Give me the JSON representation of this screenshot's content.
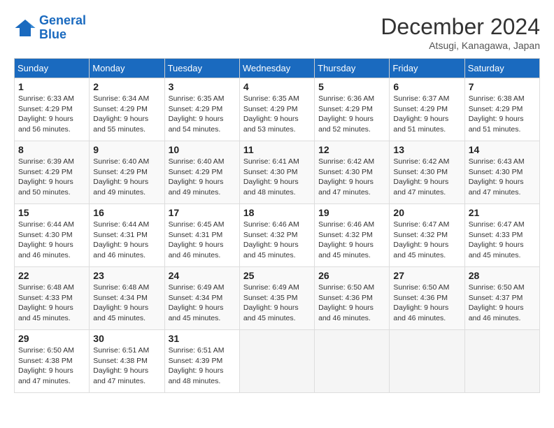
{
  "logo": {
    "line1": "General",
    "line2": "Blue"
  },
  "title": "December 2024",
  "location": "Atsugi, Kanagawa, Japan",
  "days_of_week": [
    "Sunday",
    "Monday",
    "Tuesday",
    "Wednesday",
    "Thursday",
    "Friday",
    "Saturday"
  ],
  "weeks": [
    [
      {
        "day": "1",
        "sunrise": "6:33 AM",
        "sunset": "4:29 PM",
        "daylight": "9 hours and 56 minutes."
      },
      {
        "day": "2",
        "sunrise": "6:34 AM",
        "sunset": "4:29 PM",
        "daylight": "9 hours and 55 minutes."
      },
      {
        "day": "3",
        "sunrise": "6:35 AM",
        "sunset": "4:29 PM",
        "daylight": "9 hours and 54 minutes."
      },
      {
        "day": "4",
        "sunrise": "6:35 AM",
        "sunset": "4:29 PM",
        "daylight": "9 hours and 53 minutes."
      },
      {
        "day": "5",
        "sunrise": "6:36 AM",
        "sunset": "4:29 PM",
        "daylight": "9 hours and 52 minutes."
      },
      {
        "day": "6",
        "sunrise": "6:37 AM",
        "sunset": "4:29 PM",
        "daylight": "9 hours and 51 minutes."
      },
      {
        "day": "7",
        "sunrise": "6:38 AM",
        "sunset": "4:29 PM",
        "daylight": "9 hours and 51 minutes."
      }
    ],
    [
      {
        "day": "8",
        "sunrise": "6:39 AM",
        "sunset": "4:29 PM",
        "daylight": "9 hours and 50 minutes."
      },
      {
        "day": "9",
        "sunrise": "6:40 AM",
        "sunset": "4:29 PM",
        "daylight": "9 hours and 49 minutes."
      },
      {
        "day": "10",
        "sunrise": "6:40 AM",
        "sunset": "4:29 PM",
        "daylight": "9 hours and 49 minutes."
      },
      {
        "day": "11",
        "sunrise": "6:41 AM",
        "sunset": "4:30 PM",
        "daylight": "9 hours and 48 minutes."
      },
      {
        "day": "12",
        "sunrise": "6:42 AM",
        "sunset": "4:30 PM",
        "daylight": "9 hours and 47 minutes."
      },
      {
        "day": "13",
        "sunrise": "6:42 AM",
        "sunset": "4:30 PM",
        "daylight": "9 hours and 47 minutes."
      },
      {
        "day": "14",
        "sunrise": "6:43 AM",
        "sunset": "4:30 PM",
        "daylight": "9 hours and 47 minutes."
      }
    ],
    [
      {
        "day": "15",
        "sunrise": "6:44 AM",
        "sunset": "4:30 PM",
        "daylight": "9 hours and 46 minutes."
      },
      {
        "day": "16",
        "sunrise": "6:44 AM",
        "sunset": "4:31 PM",
        "daylight": "9 hours and 46 minutes."
      },
      {
        "day": "17",
        "sunrise": "6:45 AM",
        "sunset": "4:31 PM",
        "daylight": "9 hours and 46 minutes."
      },
      {
        "day": "18",
        "sunrise": "6:46 AM",
        "sunset": "4:32 PM",
        "daylight": "9 hours and 45 minutes."
      },
      {
        "day": "19",
        "sunrise": "6:46 AM",
        "sunset": "4:32 PM",
        "daylight": "9 hours and 45 minutes."
      },
      {
        "day": "20",
        "sunrise": "6:47 AM",
        "sunset": "4:32 PM",
        "daylight": "9 hours and 45 minutes."
      },
      {
        "day": "21",
        "sunrise": "6:47 AM",
        "sunset": "4:33 PM",
        "daylight": "9 hours and 45 minutes."
      }
    ],
    [
      {
        "day": "22",
        "sunrise": "6:48 AM",
        "sunset": "4:33 PM",
        "daylight": "9 hours and 45 minutes."
      },
      {
        "day": "23",
        "sunrise": "6:48 AM",
        "sunset": "4:34 PM",
        "daylight": "9 hours and 45 minutes."
      },
      {
        "day": "24",
        "sunrise": "6:49 AM",
        "sunset": "4:34 PM",
        "daylight": "9 hours and 45 minutes."
      },
      {
        "day": "25",
        "sunrise": "6:49 AM",
        "sunset": "4:35 PM",
        "daylight": "9 hours and 45 minutes."
      },
      {
        "day": "26",
        "sunrise": "6:50 AM",
        "sunset": "4:36 PM",
        "daylight": "9 hours and 46 minutes."
      },
      {
        "day": "27",
        "sunrise": "6:50 AM",
        "sunset": "4:36 PM",
        "daylight": "9 hours and 46 minutes."
      },
      {
        "day": "28",
        "sunrise": "6:50 AM",
        "sunset": "4:37 PM",
        "daylight": "9 hours and 46 minutes."
      }
    ],
    [
      {
        "day": "29",
        "sunrise": "6:50 AM",
        "sunset": "4:38 PM",
        "daylight": "9 hours and 47 minutes."
      },
      {
        "day": "30",
        "sunrise": "6:51 AM",
        "sunset": "4:38 PM",
        "daylight": "9 hours and 47 minutes."
      },
      {
        "day": "31",
        "sunrise": "6:51 AM",
        "sunset": "4:39 PM",
        "daylight": "9 hours and 48 minutes."
      },
      null,
      null,
      null,
      null
    ]
  ]
}
